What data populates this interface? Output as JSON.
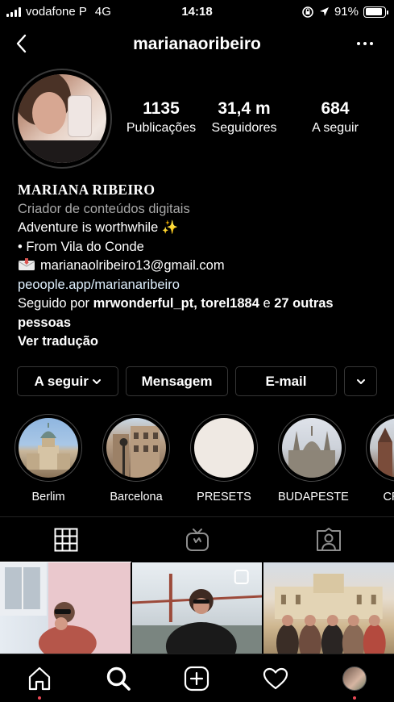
{
  "status_bar": {
    "carrier": "vodafone P",
    "network": "4G",
    "time": "14:18",
    "battery": "91%",
    "battery_level": 0.91
  },
  "header": {
    "username": "marianaoribeiro"
  },
  "stats": [
    {
      "value": "1135",
      "label": "Publicações"
    },
    {
      "value": "31,4 m",
      "label": "Seguidores"
    },
    {
      "value": "684",
      "label": "A seguir"
    }
  ],
  "bio": {
    "name": "MARIANA RIBEIRO",
    "category": "Criador de conteúdos digitais",
    "line1": "Adventure is worthwhile ✨",
    "line2": "• From Vila do Conde",
    "email": "marianaolribeiro13@gmail.com",
    "link": "peoople.app/marianaribeiro",
    "followed_prefix": "Seguido por ",
    "followed_users": "mrwonderful_pt, torel1884",
    "followed_and": " e ",
    "followed_others": "27 outras pessoas",
    "translate": "Ver tradução"
  },
  "buttons": {
    "following": "A seguir",
    "message": "Mensagem",
    "email": "E-mail"
  },
  "highlights": [
    {
      "label": "Berlim"
    },
    {
      "label": "Barcelona"
    },
    {
      "label": "PRESETS"
    },
    {
      "label": "BUDAPESTE"
    },
    {
      "label": "CRAC"
    }
  ],
  "icons": {
    "tabs": [
      "grid-icon",
      "igtv-icon",
      "tagged-icon"
    ],
    "bottom": [
      "home-icon",
      "search-icon",
      "new-post-icon",
      "activity-icon",
      "profile-icon"
    ]
  }
}
